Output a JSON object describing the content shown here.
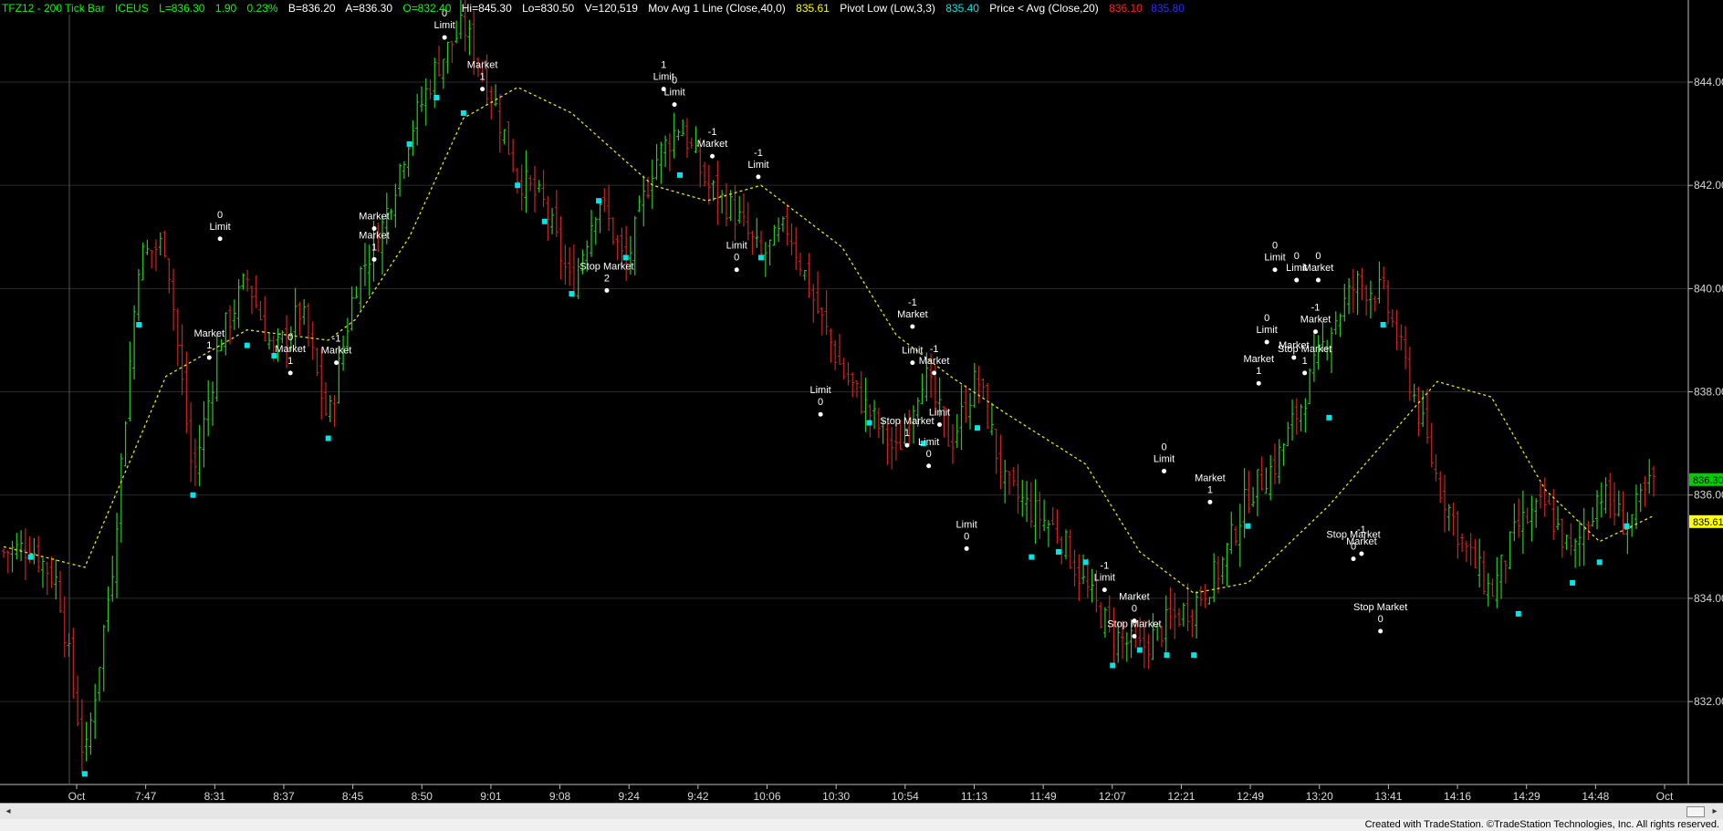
{
  "header": {
    "symbol": "TFZ12 - 200 Tick Bar",
    "exchange": "ICEUS",
    "last": "L=836.30",
    "change": "1.90",
    "change_pct": "0.23%",
    "bid": "B=836.20",
    "ask": "A=836.30",
    "open": "O=832.40",
    "high": "Hi=845.30",
    "low": "Lo=830.50",
    "volume": "V=120,519",
    "study1_name": "Mov Avg 1 Line (Close,40,0)",
    "study1_value": "835.61",
    "study2_name": "Pivot Low (Low,3,3)",
    "study2_value": "835.40",
    "study3_name": "Price < Avg (Close,20)",
    "study3_value1": "836.10",
    "study3_value2": "835.80"
  },
  "colors": {
    "up_bar": "#22cc22",
    "down_bar": "#cc2222",
    "moving_average": "#e6e600",
    "pivot_low": "#00e5e5",
    "last_price_tag": "#00cc00",
    "average_tag": "#ffff00",
    "grid": "#2b2b2b"
  },
  "chart_data": {
    "type": "bar",
    "price_axis_ticks": [
      "844.00",
      "842.00",
      "840.00",
      "838.00",
      "836.00",
      "834.00",
      "832.00"
    ],
    "price_range": [
      830.5,
      845.3
    ],
    "time_axis_labels": [
      "Oct",
      "7:47",
      "8:31",
      "8:37",
      "8:45",
      "8:50",
      "9:01",
      "9:08",
      "9:24",
      "9:42",
      "10:06",
      "10:30",
      "10:54",
      "11:13",
      "11:49",
      "12:07",
      "12:21",
      "12:49",
      "13:20",
      "13:41",
      "14:16",
      "14:29",
      "14:48",
      "Oct"
    ],
    "last_price": "836.30",
    "average_value": "835.61",
    "close_path": [
      {
        "t": 0,
        "p": 834.9
      },
      {
        "t": 1,
        "p": 835.0
      },
      {
        "t": 2,
        "p": 834.3
      },
      {
        "t": 3,
        "p": 830.8
      },
      {
        "t": 4,
        "p": 834.5
      },
      {
        "t": 5,
        "p": 840.6
      },
      {
        "t": 6,
        "p": 840.9
      },
      {
        "t": 7,
        "p": 836.3
      },
      {
        "t": 8,
        "p": 839.0
      },
      {
        "t": 9,
        "p": 840.2
      },
      {
        "t": 10,
        "p": 838.7
      },
      {
        "t": 11,
        "p": 839.6
      },
      {
        "t": 12,
        "p": 837.4
      },
      {
        "t": 13,
        "p": 840.1
      },
      {
        "t": 14,
        "p": 841.2
      },
      {
        "t": 15,
        "p": 843.0
      },
      {
        "t": 16,
        "p": 844.3
      },
      {
        "t": 17,
        "p": 845.1
      },
      {
        "t": 18,
        "p": 843.8
      },
      {
        "t": 19,
        "p": 842.2
      },
      {
        "t": 20,
        "p": 841.6
      },
      {
        "t": 21,
        "p": 840.0
      },
      {
        "t": 22,
        "p": 841.8
      },
      {
        "t": 23,
        "p": 840.4
      },
      {
        "t": 24,
        "p": 842.4
      },
      {
        "t": 25,
        "p": 843.2
      },
      {
        "t": 26,
        "p": 842.0
      },
      {
        "t": 27,
        "p": 841.5
      },
      {
        "t": 28,
        "p": 840.6
      },
      {
        "t": 29,
        "p": 841.2
      },
      {
        "t": 30,
        "p": 839.7
      },
      {
        "t": 31,
        "p": 838.4
      },
      {
        "t": 32,
        "p": 837.6
      },
      {
        "t": 33,
        "p": 836.8
      },
      {
        "t": 34,
        "p": 838.4
      },
      {
        "t": 35,
        "p": 837.0
      },
      {
        "t": 36,
        "p": 838.3
      },
      {
        "t": 37,
        "p": 836.2
      },
      {
        "t": 38,
        "p": 835.7
      },
      {
        "t": 39,
        "p": 835.3
      },
      {
        "t": 40,
        "p": 834.2
      },
      {
        "t": 41,
        "p": 833.3
      },
      {
        "t": 42,
        "p": 833.0
      },
      {
        "t": 43,
        "p": 833.5
      },
      {
        "t": 44,
        "p": 833.9
      },
      {
        "t": 45,
        "p": 834.6
      },
      {
        "t": 46,
        "p": 836.0
      },
      {
        "t": 47,
        "p": 836.6
      },
      {
        "t": 48,
        "p": 837.8
      },
      {
        "t": 49,
        "p": 839.2
      },
      {
        "t": 50,
        "p": 840.1
      },
      {
        "t": 51,
        "p": 839.9
      },
      {
        "t": 52,
        "p": 838.2
      },
      {
        "t": 53,
        "p": 836.3
      },
      {
        "t": 54,
        "p": 835.0
      },
      {
        "t": 55,
        "p": 834.1
      },
      {
        "t": 56,
        "p": 835.4
      },
      {
        "t": 57,
        "p": 835.8
      },
      {
        "t": 58,
        "p": 834.8
      },
      {
        "t": 59,
        "p": 836.1
      },
      {
        "t": 60,
        "p": 835.4
      },
      {
        "t": 61,
        "p": 836.3
      }
    ],
    "moving_average": [
      {
        "t": 0,
        "p": 835.0
      },
      {
        "t": 3,
        "p": 834.6
      },
      {
        "t": 6,
        "p": 838.3
      },
      {
        "t": 9,
        "p": 839.2
      },
      {
        "t": 12,
        "p": 839.0
      },
      {
        "t": 13,
        "p": 839.4
      },
      {
        "t": 15,
        "p": 841.0
      },
      {
        "t": 17,
        "p": 843.3
      },
      {
        "t": 19,
        "p": 843.9
      },
      {
        "t": 21,
        "p": 843.4
      },
      {
        "t": 24,
        "p": 842.0
      },
      {
        "t": 26,
        "p": 841.7
      },
      {
        "t": 28,
        "p": 842.0
      },
      {
        "t": 31,
        "p": 840.8
      },
      {
        "t": 33,
        "p": 839.1
      },
      {
        "t": 35,
        "p": 838.3
      },
      {
        "t": 37,
        "p": 837.6
      },
      {
        "t": 40,
        "p": 836.6
      },
      {
        "t": 42,
        "p": 834.9
      },
      {
        "t": 44,
        "p": 834.1
      },
      {
        "t": 46,
        "p": 834.3
      },
      {
        "t": 49,
        "p": 835.8
      },
      {
        "t": 51,
        "p": 837.0
      },
      {
        "t": 53,
        "p": 838.2
      },
      {
        "t": 55,
        "p": 837.9
      },
      {
        "t": 57,
        "p": 836.1
      },
      {
        "t": 59,
        "p": 835.1
      },
      {
        "t": 61,
        "p": 835.6
      }
    ],
    "pivot_lows": [
      {
        "t": 1,
        "p": 834.8
      },
      {
        "t": 3,
        "p": 830.6
      },
      {
        "t": 5,
        "p": 839.3
      },
      {
        "t": 7,
        "p": 836.0
      },
      {
        "t": 9,
        "p": 838.9
      },
      {
        "t": 10,
        "p": 838.7
      },
      {
        "t": 12,
        "p": 837.1
      },
      {
        "t": 15,
        "p": 842.8
      },
      {
        "t": 16,
        "p": 843.7
      },
      {
        "t": 17,
        "p": 843.4
      },
      {
        "t": 19,
        "p": 842.0
      },
      {
        "t": 20,
        "p": 841.3
      },
      {
        "t": 21,
        "p": 839.9
      },
      {
        "t": 22,
        "p": 841.7
      },
      {
        "t": 23,
        "p": 840.6
      },
      {
        "t": 25,
        "p": 842.2
      },
      {
        "t": 28,
        "p": 840.6
      },
      {
        "t": 32,
        "p": 837.4
      },
      {
        "t": 34,
        "p": 837.0
      },
      {
        "t": 36,
        "p": 837.3
      },
      {
        "t": 38,
        "p": 834.8
      },
      {
        "t": 39,
        "p": 834.9
      },
      {
        "t": 40,
        "p": 834.7
      },
      {
        "t": 41,
        "p": 832.7
      },
      {
        "t": 42,
        "p": 833.0
      },
      {
        "t": 43,
        "p": 832.9
      },
      {
        "t": 44,
        "p": 832.9
      },
      {
        "t": 46,
        "p": 835.4
      },
      {
        "t": 49,
        "p": 837.5
      },
      {
        "t": 51,
        "p": 839.3
      },
      {
        "t": 56,
        "p": 833.7
      },
      {
        "t": 58,
        "p": 834.3
      },
      {
        "t": 59,
        "p": 834.7
      },
      {
        "t": 60,
        "p": 835.4
      }
    ],
    "annotations": [
      {
        "t": 8,
        "p": 841.0,
        "lines": [
          "0",
          "Limit"
        ]
      },
      {
        "t": 7.6,
        "p": 838.7,
        "lines": [
          "Market",
          "1"
        ]
      },
      {
        "t": 10.6,
        "p": 838.4,
        "lines": [
          "0",
          "Market",
          "1"
        ]
      },
      {
        "t": 12.3,
        "p": 838.6,
        "lines": [
          "-1",
          "Market"
        ]
      },
      {
        "t": 13.7,
        "p": 841.2,
        "lines": [
          "Market"
        ]
      },
      {
        "t": 13.7,
        "p": 840.6,
        "lines": [
          "Market",
          "1"
        ]
      },
      {
        "t": 16.3,
        "p": 844.9,
        "lines": [
          "0",
          "Limit"
        ]
      },
      {
        "t": 17.7,
        "p": 843.9,
        "lines": [
          "Market",
          "1"
        ]
      },
      {
        "t": 22.3,
        "p": 840.0,
        "lines": [
          "Stop Market",
          "2"
        ]
      },
      {
        "t": 24.4,
        "p": 843.9,
        "lines": [
          "1",
          "Limit"
        ]
      },
      {
        "t": 24.8,
        "p": 843.6,
        "lines": [
          "0",
          "Limit"
        ]
      },
      {
        "t": 26.2,
        "p": 842.6,
        "lines": [
          "-1",
          "Market"
        ]
      },
      {
        "t": 27.1,
        "p": 840.4,
        "lines": [
          "Limit",
          "0"
        ]
      },
      {
        "t": 27.9,
        "p": 842.2,
        "lines": [
          "-1",
          "Limit"
        ]
      },
      {
        "t": 30.2,
        "p": 837.6,
        "lines": [
          "Limit",
          "0"
        ]
      },
      {
        "t": 33.6,
        "p": 839.3,
        "lines": [
          "-1",
          "Market"
        ]
      },
      {
        "t": 33.6,
        "p": 838.6,
        "lines": [
          "Limit"
        ]
      },
      {
        "t": 34.4,
        "p": 838.4,
        "lines": [
          "-1",
          "Market"
        ]
      },
      {
        "t": 33.4,
        "p": 837.0,
        "lines": [
          "Stop Market",
          "1"
        ]
      },
      {
        "t": 34.2,
        "p": 836.6,
        "lines": [
          "Limit",
          "0"
        ]
      },
      {
        "t": 34.6,
        "p": 837.4,
        "lines": [
          "Limit"
        ]
      },
      {
        "t": 35.6,
        "p": 835.0,
        "lines": [
          "Limit",
          "0"
        ]
      },
      {
        "t": 40.7,
        "p": 834.2,
        "lines": [
          "-1",
          "Limit"
        ]
      },
      {
        "t": 41.8,
        "p": 833.6,
        "lines": [
          "Market",
          "0"
        ]
      },
      {
        "t": 41.8,
        "p": 833.3,
        "lines": [
          "Stop Market"
        ]
      },
      {
        "t": 42.9,
        "p": 836.5,
        "lines": [
          "0",
          "Limit"
        ]
      },
      {
        "t": 44.6,
        "p": 835.9,
        "lines": [
          "Market",
          "1"
        ]
      },
      {
        "t": 47.0,
        "p": 840.4,
        "lines": [
          "0",
          "Limit"
        ]
      },
      {
        "t": 47.8,
        "p": 840.2,
        "lines": [
          "0",
          "Limit"
        ]
      },
      {
        "t": 48.6,
        "p": 840.2,
        "lines": [
          "0",
          "Market"
        ]
      },
      {
        "t": 46.7,
        "p": 839.0,
        "lines": [
          "0",
          "Limit"
        ]
      },
      {
        "t": 47.7,
        "p": 838.7,
        "lines": [
          "Market"
        ]
      },
      {
        "t": 48.5,
        "p": 839.2,
        "lines": [
          "-1",
          "Market"
        ]
      },
      {
        "t": 48.1,
        "p": 838.4,
        "lines": [
          "Stop Market",
          "1"
        ]
      },
      {
        "t": 46.4,
        "p": 838.2,
        "lines": [
          "Market",
          "1"
        ]
      },
      {
        "t": 50.2,
        "p": 834.9,
        "lines": [
          "-1",
          "Market"
        ]
      },
      {
        "t": 49.9,
        "p": 834.8,
        "lines": [
          "Stop Market",
          "0"
        ]
      },
      {
        "t": 50.9,
        "p": 833.4,
        "lines": [
          "Stop Market",
          "0"
        ]
      }
    ]
  },
  "scrollbar": {
    "left_arrow": "◂",
    "right_arrow": "▸"
  },
  "footer": {
    "text": "Created with TradeStation. ©TradeStation Technologies, Inc. All rights reserved."
  }
}
